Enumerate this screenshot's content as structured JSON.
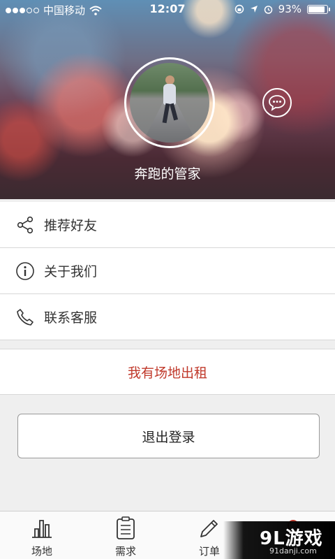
{
  "status_bar": {
    "carrier": "中国移动",
    "time": "12:07",
    "battery_percent": "93%",
    "battery_level": 0.93
  },
  "profile": {
    "username": "奔跑的管家"
  },
  "menu": {
    "items": [
      {
        "label": "推荐好友",
        "icon": "share-icon"
      },
      {
        "label": "关于我们",
        "icon": "info-icon"
      },
      {
        "label": "联系客服",
        "icon": "phone-icon"
      }
    ]
  },
  "rent": {
    "label": "我有场地出租",
    "color": "#c0392b"
  },
  "logout": {
    "label": "退出登录"
  },
  "tabs": [
    {
      "label": "场地",
      "icon": "venue-icon"
    },
    {
      "label": "需求",
      "icon": "clipboard-icon"
    },
    {
      "label": "订单",
      "icon": "pencil-icon"
    },
    {
      "label": "",
      "icon": "profile-icon"
    }
  ],
  "watermark": {
    "main": "9L游戏",
    "sub": "91danji.com"
  }
}
